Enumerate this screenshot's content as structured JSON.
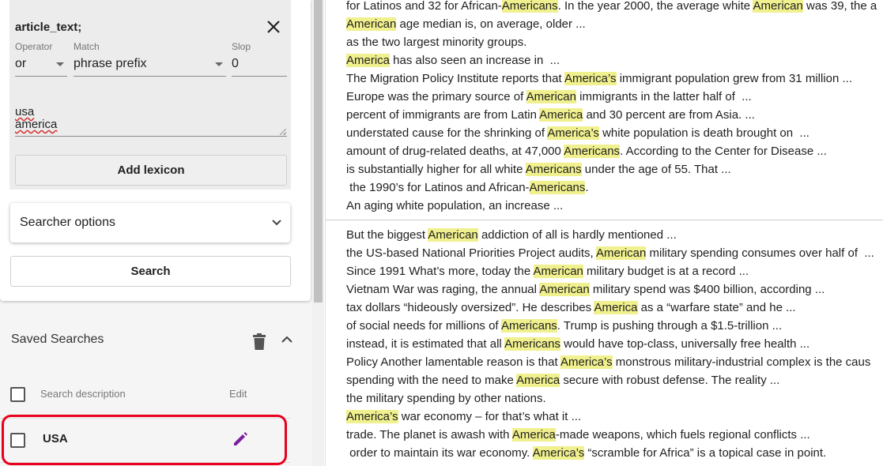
{
  "lexicon": {
    "title": "article_text;",
    "operator_label": "Operator",
    "operator_value": "or",
    "match_label": "Match",
    "match_value": "phrase prefix",
    "slop_label": "Slop",
    "slop_value": "0",
    "terms": [
      "usa",
      "america"
    ],
    "add_button": "Add lexicon"
  },
  "searcher_options_label": "Searcher options",
  "search_button": "Search",
  "saved": {
    "header": "Saved Searches",
    "col_description": "Search description",
    "col_edit": "Edit",
    "rows": [
      {
        "name": "USA"
      }
    ]
  },
  "colors": {
    "highlight": "#f0f08e",
    "accent": "#7b1fa2",
    "ring": "#e8001c"
  },
  "results": {
    "group1": [
      [
        [
          "for Latinos and 32 for African-",
          false
        ],
        [
          "Americans",
          true
        ],
        [
          ". In the year 2000, the average white ",
          false
        ],
        [
          "American",
          true
        ],
        [
          " was 39, the a",
          false
        ]
      ],
      [
        [
          "American",
          true
        ],
        [
          " age median is, on average, older ...",
          false
        ]
      ],
      [
        [
          "as the two largest minority groups.",
          false
        ]
      ],
      [
        [
          "America",
          true
        ],
        [
          " has also seen an increase in  ...",
          false
        ]
      ],
      [
        [
          "The Migration Policy Institute reports that ",
          false
        ],
        [
          "America’s",
          true
        ],
        [
          " immigrant population grew from 31 million ...",
          false
        ]
      ],
      [
        [
          "Europe was the primary source of ",
          false
        ],
        [
          "American",
          true
        ],
        [
          " immigrants in the latter half of  ...",
          false
        ]
      ],
      [
        [
          "percent of immigrants are from Latin ",
          false
        ],
        [
          "America",
          true
        ],
        [
          " and 30 percent are from Asia. ...",
          false
        ]
      ],
      [
        [
          "understated cause for the shrinking of ",
          false
        ],
        [
          "America’s",
          true
        ],
        [
          " white population is death brought on  ...",
          false
        ]
      ],
      [
        [
          "amount of drug-related deaths, at 47,000 ",
          false
        ],
        [
          "Americans",
          true
        ],
        [
          ". According to the Center for Disease ...",
          false
        ]
      ],
      [
        [
          "is substantially higher for all white ",
          false
        ],
        [
          "Americans",
          true
        ],
        [
          " under the age of 55. That ...",
          false
        ]
      ],
      [
        [
          " the 1990’s for Latinos and African-",
          false
        ],
        [
          "Americans",
          true
        ],
        [
          ".",
          false
        ]
      ],
      [
        [
          "An aging white population, an increase ...",
          false
        ]
      ]
    ],
    "group2": [
      [
        [
          "But the biggest ",
          false
        ],
        [
          "American",
          true
        ],
        [
          " addiction of all is hardly mentioned ...",
          false
        ]
      ],
      [
        [
          "the US-based National Priorities Project audits, ",
          false
        ],
        [
          "American",
          true
        ],
        [
          " military spending consumes over half of  ...",
          false
        ]
      ],
      [
        [
          "Since 1991 What’s more, today the ",
          false
        ],
        [
          "American",
          true
        ],
        [
          " military budget is at a record ...",
          false
        ]
      ],
      [
        [
          "Vietnam War was raging, the annual ",
          false
        ],
        [
          "American",
          true
        ],
        [
          " military spend was $400 billion, according ...",
          false
        ]
      ],
      [
        [
          "tax dollars “hideously oversized”. He describes ",
          false
        ],
        [
          "America",
          true
        ],
        [
          " as a “warfare state” and he ...",
          false
        ]
      ],
      [
        [
          "of social needs for millions of ",
          false
        ],
        [
          "Americans",
          true
        ],
        [
          ". Trump is pushing through a $1.5-trillion ...",
          false
        ]
      ],
      [
        [
          "instead, it is estimated that all ",
          false
        ],
        [
          "Americans",
          true
        ],
        [
          " would have top-class, universally free health ...",
          false
        ]
      ],
      [
        [
          "Policy Another lamentable reason is that ",
          false
        ],
        [
          "America’s",
          true
        ],
        [
          " monstrous military-industrial complex is the caus",
          false
        ]
      ],
      [
        [
          "spending with the need to make ",
          false
        ],
        [
          "America",
          true
        ],
        [
          " secure with robust defense. The reality ...",
          false
        ]
      ],
      [
        [
          "the military spending by other nations.",
          false
        ]
      ],
      [
        [
          "America’s",
          true
        ],
        [
          " war economy – for that’s what it ...",
          false
        ]
      ],
      [
        [
          "trade. The planet is awash with ",
          false
        ],
        [
          "America",
          true
        ],
        [
          "-made weapons, which fuels regional conflicts ...",
          false
        ]
      ],
      [
        [
          " order to maintain its war economy. ",
          false
        ],
        [
          "America’s",
          true
        ],
        [
          " “scramble for Africa” is a topical case in point.",
          false
        ]
      ]
    ]
  }
}
